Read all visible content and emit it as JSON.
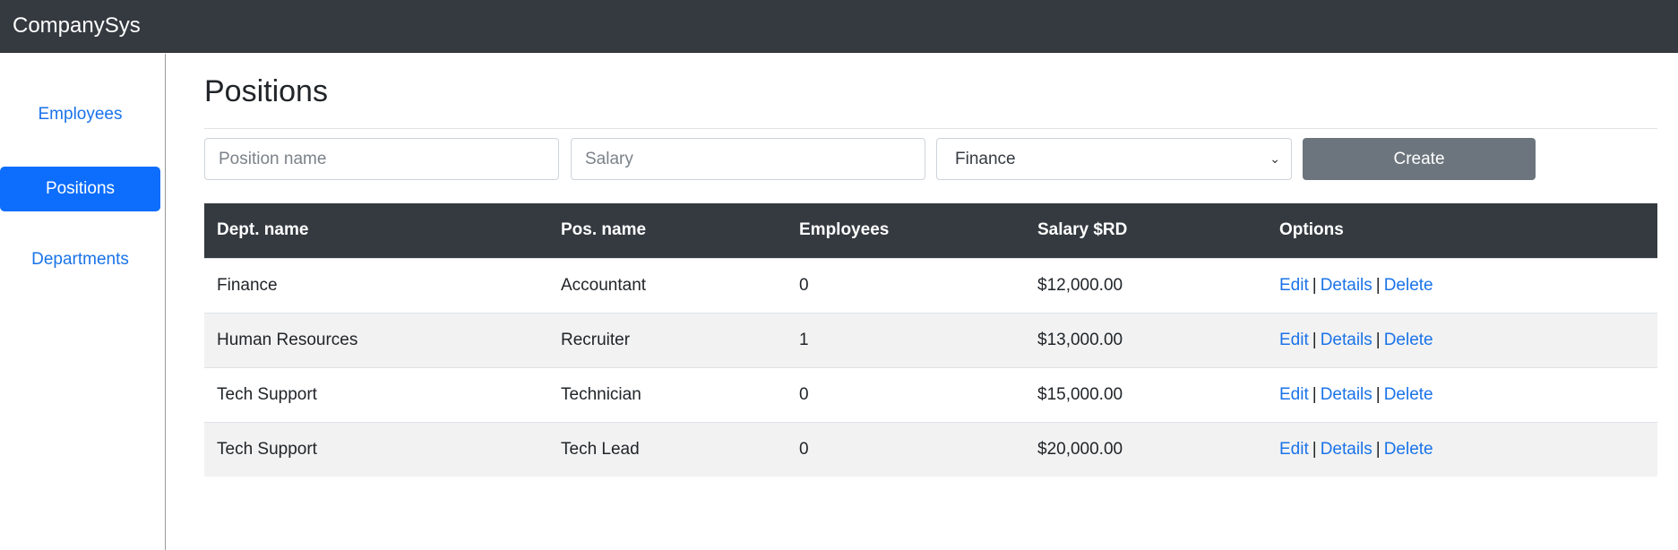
{
  "app": {
    "brand": "CompanySys"
  },
  "sidebar": {
    "items": [
      {
        "label": "Employees",
        "active": false
      },
      {
        "label": "Positions",
        "active": true
      },
      {
        "label": "Departments",
        "active": false
      }
    ]
  },
  "page": {
    "title": "Positions"
  },
  "form": {
    "position_placeholder": "Position name",
    "position_value": "",
    "salary_placeholder": "Salary",
    "salary_value": "",
    "department_selected": "Finance",
    "create_label": "Create"
  },
  "table": {
    "headers": [
      "Dept. name",
      "Pos. name",
      "Employees",
      "Salary $RD",
      "Options"
    ],
    "rows": [
      {
        "dept": "Finance",
        "position": "Accountant",
        "employees": "0",
        "salary": "$12,000.00"
      },
      {
        "dept": "Human Resources",
        "position": "Recruiter",
        "employees": "1",
        "salary": "$13,000.00"
      },
      {
        "dept": "Tech Support",
        "position": "Technician",
        "employees": "0",
        "salary": "$15,000.00"
      },
      {
        "dept": "Tech Support",
        "position": "Tech Lead",
        "employees": "0",
        "salary": "$20,000.00"
      }
    ],
    "option_labels": {
      "edit": "Edit",
      "details": "Details",
      "delete": "Delete",
      "separator": "|"
    }
  },
  "colors": {
    "navbar": "#343a40",
    "active_nav": "#0d6efd",
    "link": "#1a73e8",
    "button": "#6c757d",
    "stripe": "#f2f2f2"
  },
  "icons": {
    "select_chevron": "chevron-down-icon"
  }
}
